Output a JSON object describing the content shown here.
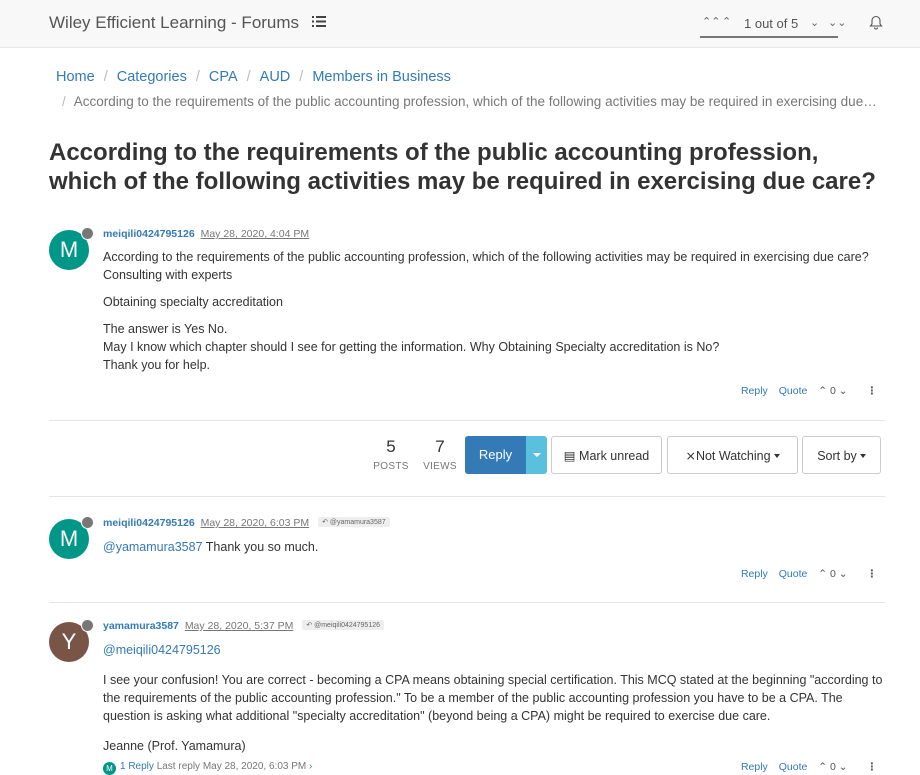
{
  "header": {
    "brand": "Wiley Efficient Learning - Forums",
    "pagination": "1 out of 5"
  },
  "breadcrumb": {
    "items": [
      "Home",
      "Categories",
      "CPA",
      "AUD",
      "Members in Business"
    ],
    "current": "According to the requirements of the public accounting profession, which of the following activities may be required in exercising due care?"
  },
  "topic": {
    "title": "According to the requirements of the public accounting profession, which of the following activities may be required in exercising due care?",
    "posts_count": "5",
    "posts_label": "POSTS",
    "views_count": "7",
    "views_label": "VIEWS"
  },
  "toolbar": {
    "reply_label": "Reply",
    "mark_unread_label": "Mark unread",
    "watching_label": "Not Watching",
    "sort_label": "Sort by"
  },
  "colors": {
    "primary": "#337ab7",
    "info": "#5bc0de",
    "avatar_m": "#009688",
    "avatar_y": "#795548"
  },
  "posts": [
    {
      "avatar_letter": "M",
      "username": "meiqili0424795126",
      "timestamp": "May 28, 2020, 4:04 PM",
      "lines": [
        "According to the requirements of the public accounting profession, which of the following activities may be required in exercising due care?",
        "Consulting with experts",
        "Obtaining specialty accreditation",
        "The answer is Yes No.",
        "May I know which chapter should I see for getting the information. Why Obtaining Specialty accreditation is No?",
        "Thank you for help."
      ],
      "reply_label": "Reply",
      "quote_label": "Quote",
      "votes": "0"
    },
    {
      "avatar_letter": "M",
      "username": "meiqili0424795126",
      "timestamp": "May 28, 2020, 6:03 PM",
      "parent": "@yamamura3587",
      "mention": "@yamamura3587",
      "text": "Thank you so much.",
      "reply_label": "Reply",
      "quote_label": "Quote",
      "votes": "0"
    },
    {
      "avatar_letter": "Y",
      "username": "yamamura3587",
      "timestamp": "May 28, 2020, 5:37 PM",
      "parent": "@meiqili0424795126",
      "mention": "@meiqili0424795126",
      "paragraph": "I see your confusion! You are correct - becoming a CPA means obtaining special certification. This MCQ stated at the beginning \"according to the requirements of the public accounting profession.\" To be a member of the public accounting profession you have to be a CPA. The question is asking what additional \"specialty accreditation\" (beyond being a CPA) might be required to exercise due care.",
      "signature": "Jeanne (Prof. Yamamura)",
      "replies_count": "1 Reply",
      "last_reply": "Last reply May 28, 2020, 6:03 PM",
      "reply_label": "Reply",
      "quote_label": "Quote",
      "votes": "0"
    }
  ]
}
